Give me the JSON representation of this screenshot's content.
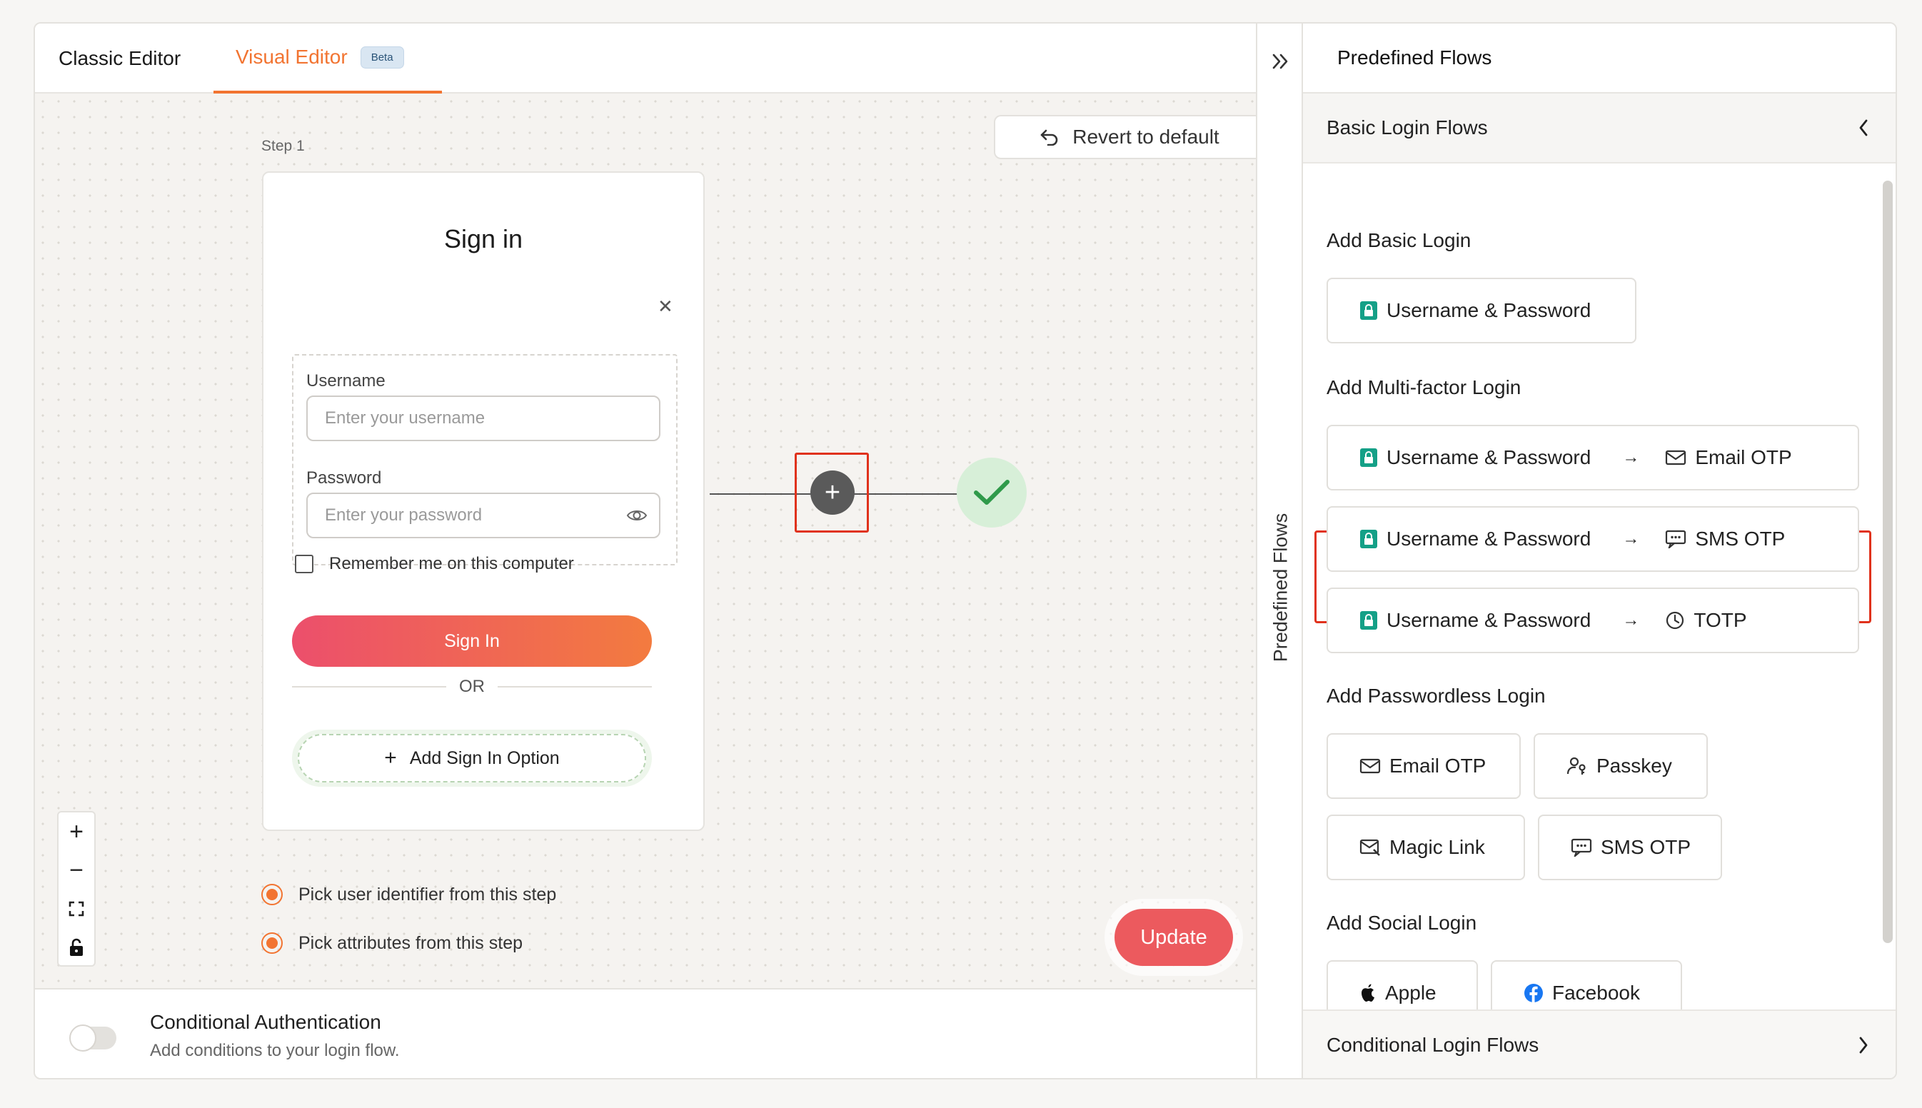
{
  "tabs": {
    "classic": "Classic Editor",
    "visual": "Visual Editor",
    "beta": "Beta"
  },
  "canvas": {
    "revert": "Revert to default",
    "step_label": "Step 1",
    "signin": {
      "title": "Sign in",
      "username_label": "Username",
      "username_placeholder": "Enter your username",
      "password_label": "Password",
      "password_placeholder": "Enter your password",
      "remember": "Remember me on this computer",
      "signin_button": "Sign In",
      "or": "OR",
      "add_option": "Add Sign In Option"
    },
    "options": [
      "Pick user identifier from this step",
      "Pick attributes from this step"
    ],
    "update": "Update"
  },
  "conditional": {
    "title": "Conditional Authentication",
    "subtitle": "Add conditions to your login flow."
  },
  "strip": {
    "label": "Predefined Flows"
  },
  "panel": {
    "title": "Predefined Flows",
    "basic_flows": "Basic Login Flows",
    "conditional_flows": "Conditional Login Flows",
    "basic_login": {
      "title": "Add Basic Login",
      "items": [
        "Username & Password"
      ]
    },
    "mfa": {
      "title": "Add Multi-factor Login",
      "items": [
        {
          "first": "Username & Password",
          "arrow": "→",
          "second": "Email OTP"
        },
        {
          "first": "Username & Password",
          "arrow": "→",
          "second": "SMS OTP"
        },
        {
          "first": "Username & Password",
          "arrow": "→",
          "second": "TOTP"
        }
      ]
    },
    "passwordless": {
      "title": "Add Passwordless Login",
      "items": [
        "Email OTP",
        "Passkey",
        "Magic Link",
        "SMS OTP"
      ]
    },
    "social": {
      "title": "Add Social Login",
      "items": [
        "Apple",
        "Facebook"
      ]
    }
  },
  "colors": {
    "accent": "#f27431",
    "highlight": "#e0321c",
    "lock": "#14a087",
    "success": "#2f9a4a"
  }
}
